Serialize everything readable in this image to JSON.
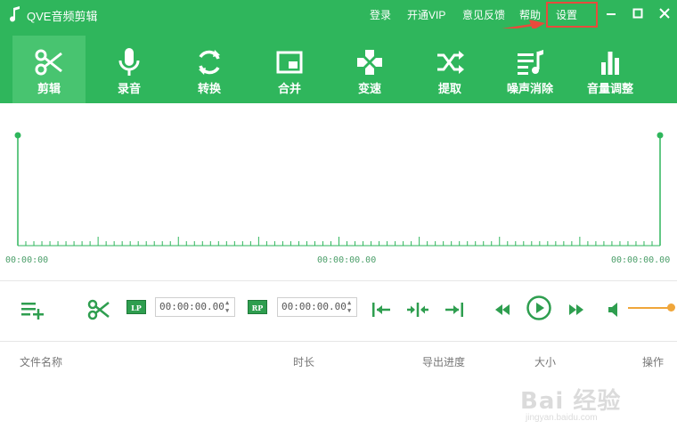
{
  "app": {
    "title": "QVE音频剪辑"
  },
  "top_menu": [
    {
      "label": "登录"
    },
    {
      "label": "开通VIP"
    },
    {
      "label": "意见反馈"
    },
    {
      "label": "帮助"
    },
    {
      "label": "设置"
    }
  ],
  "toolbar": [
    {
      "label": "剪辑",
      "icon": "scissors-icon",
      "active": true
    },
    {
      "label": "录音",
      "icon": "microphone-icon"
    },
    {
      "label": "转换",
      "icon": "convert-icon"
    },
    {
      "label": "合并",
      "icon": "merge-icon"
    },
    {
      "label": "变速",
      "icon": "speed-icon"
    },
    {
      "label": "提取",
      "icon": "shuffle-icon"
    },
    {
      "label": "噪声消除",
      "icon": "noise-removal-icon"
    },
    {
      "label": "音量调整",
      "icon": "volume-bars-icon"
    }
  ],
  "timeline": {
    "start_time": "00:00:00",
    "mid_time": "00:00:00.00",
    "end_time": "00:00:00.00"
  },
  "controls": {
    "lp_label": "LP",
    "rp_label": "RP",
    "lp_time": "00:00:00.00",
    "rp_time": "00:00:00.00",
    "volume_level": 0.95
  },
  "file_list": {
    "columns": [
      "文件名称",
      "时长",
      "导出进度",
      "大小",
      "操作"
    ]
  },
  "watermark": {
    "brand": "Bai 经验",
    "url": "jingyan.baidu.com"
  },
  "colors": {
    "primary": "#2fb65c",
    "active_tab": "#48c470",
    "annotation": "#e84a3c",
    "volume": "#f0a63a"
  }
}
